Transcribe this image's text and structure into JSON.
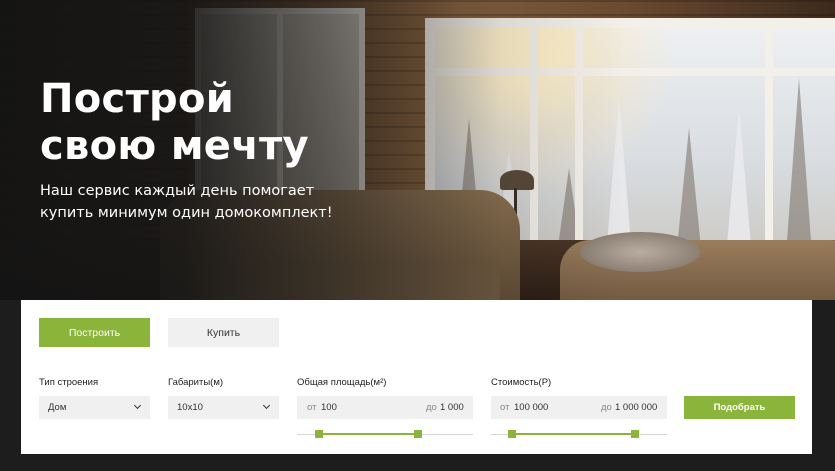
{
  "hero": {
    "title_line1": "Построй",
    "title_line2": "свою мечту",
    "subtitle_line1": "Наш сервис каждый день помогает",
    "subtitle_line2": "купить минимум один домокомплект!"
  },
  "search": {
    "tabs": {
      "build": "Построить",
      "buy": "Купить"
    },
    "building_type": {
      "label": "Тип строения",
      "value": "Дом"
    },
    "dimensions": {
      "label": "Габариты(м)",
      "value": "10x10"
    },
    "area": {
      "label": "Общая площадь(м²)",
      "from_prefix": "от",
      "from_value": "100",
      "to_prefix": "до",
      "to_value": "1 000"
    },
    "price": {
      "label": "Стоимость(Р)",
      "from_prefix": "от",
      "from_value": "100 000",
      "to_prefix": "до",
      "to_value": "1 000 000"
    },
    "submit_label": "Подобрать"
  },
  "colors": {
    "accent": "#8bb43a",
    "field_background": "#f0f0f0",
    "dark_background": "#1d1d1d"
  },
  "icons": [
    "chevron-down-icon"
  ]
}
